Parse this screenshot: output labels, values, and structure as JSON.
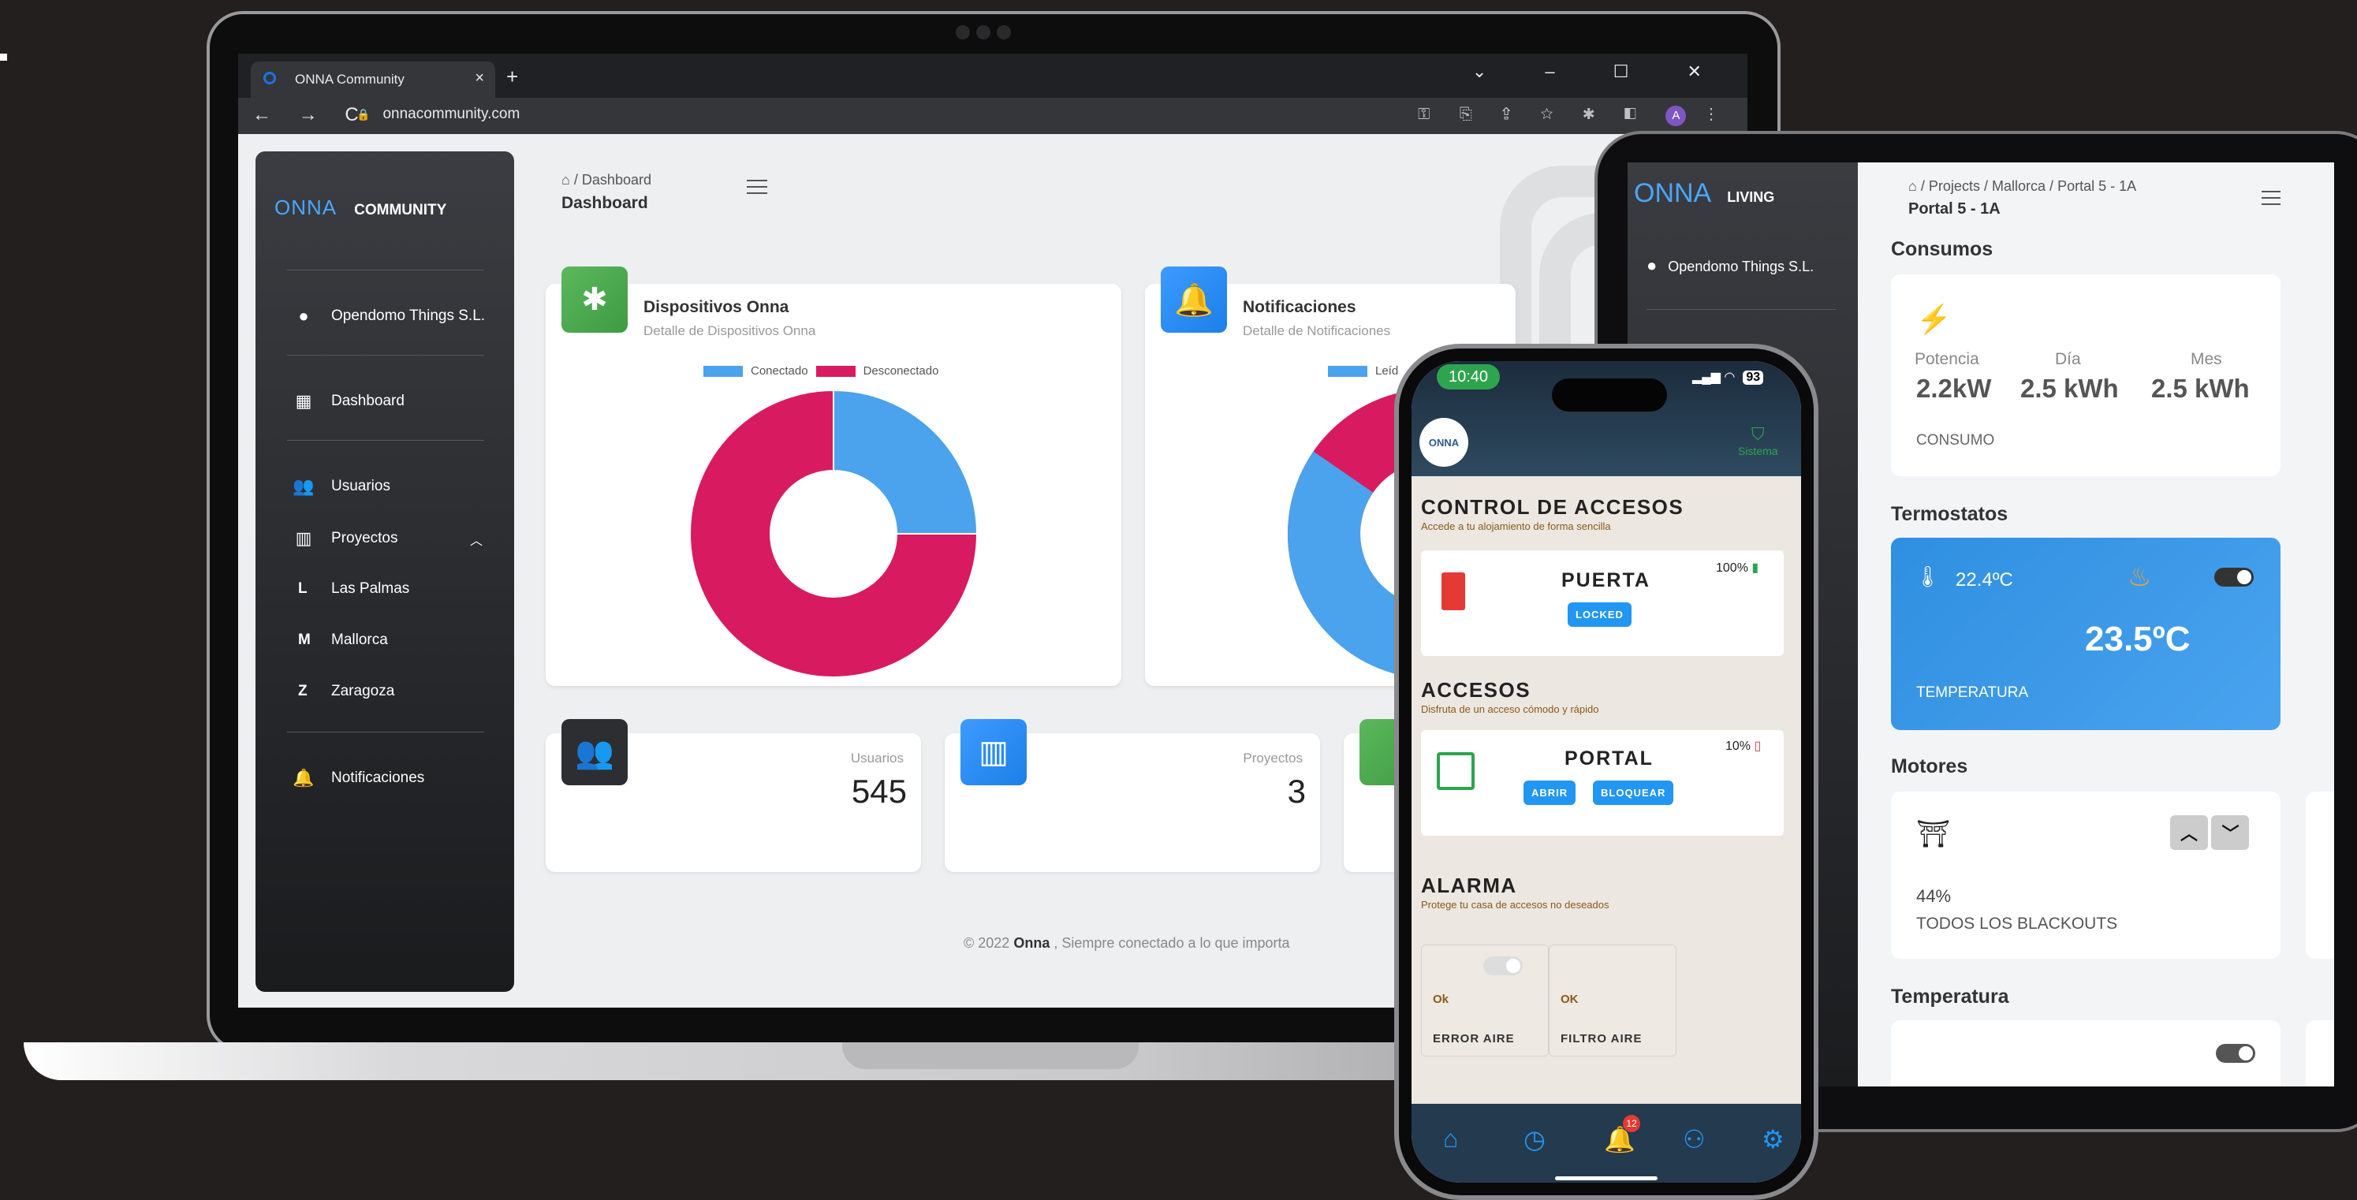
{
  "browser": {
    "tab_title": "ONNA Community",
    "tab_close": "×",
    "new_tab": "+",
    "window_controls": "⌄ – ☐ ✕",
    "nav_controls": "← → C",
    "url": "onnacommunity.com",
    "lock_icon": "🔒",
    "extension_icons": "⚿ ⎘ ⇪ ☆ ✱ ◧",
    "profile_initial": "A"
  },
  "sidebar": {
    "logo_mark": "ONNA",
    "logo_text": "COMMUNITY",
    "company": "Opendomo Things S.L.",
    "items": [
      {
        "icon": "dashboard-icon",
        "label": "Dashboard"
      },
      {
        "icon": "users-icon",
        "label": "Usuarios"
      },
      {
        "icon": "building-icon",
        "label": "Proyectos"
      }
    ],
    "projects": [
      {
        "initial": "L",
        "label": "Las Palmas"
      },
      {
        "initial": "M",
        "label": "Mallorca"
      },
      {
        "initial": "Z",
        "label": "Zaragoza"
      }
    ],
    "notifications": "Notificaciones"
  },
  "header": {
    "breadcrumb_home": "⌂",
    "breadcrumb_sep": "/",
    "breadcrumb": "Dashboard",
    "title": "Dashboard"
  },
  "cards": {
    "devices": {
      "title": "Dispositivos Onna",
      "subtitle": "Detalle de Dispositivos Onna",
      "legend": [
        "Conectado",
        "Desconectado"
      ]
    },
    "notifications": {
      "title": "Notificaciones",
      "subtitle": "Detalle de Notificaciones",
      "legend": [
        "Leíd"
      ]
    }
  },
  "stats": [
    {
      "label": "Usuarios",
      "value": "545"
    },
    {
      "label": "Proyectos",
      "value": "3"
    }
  ],
  "footer": {
    "prefix": "© 2022",
    "brand": "Onna",
    "suffix": ", Siempre conectado a lo que importa"
  },
  "tablet": {
    "logo_mark": "ONNA",
    "logo_text": "LIVING",
    "user": "Opendomo Things S.L.",
    "breadcrumb": [
      "⌂",
      "/",
      "Projects",
      "/",
      "Mallorca",
      "/",
      "Portal 5 - 1A"
    ],
    "title": "Portal 5 - 1A",
    "consumos": {
      "heading": "Consumos",
      "labels": [
        "Potencia",
        "Día",
        "Mes"
      ],
      "values": [
        "2.2kW",
        "2.5 kWh",
        "2.5 kWh"
      ],
      "footer": "CONSUMO"
    },
    "termostatos": {
      "heading": "Termostatos",
      "current": "22.4ºC",
      "target": "23.5ºC",
      "label": "TEMPERATURA"
    },
    "motores": {
      "heading": "Motores",
      "percent": "44%",
      "label": "TODOS LOS BLACKOUTS"
    },
    "temperatura": {
      "heading": "Temperatura"
    }
  },
  "phone": {
    "time": "10:40",
    "battery": "93",
    "logo": "ONNA",
    "system_label": "Sistema",
    "control": {
      "title": "CONTROL DE ACCESOS",
      "subtitle": "Accede a tu alojamiento de forma sencilla",
      "device": "PUERTA",
      "battery": "100%",
      "status": "LOCKED"
    },
    "accesos": {
      "title": "ACCESOS",
      "subtitle": "Disfruta de un acceso cómodo y rápido",
      "device": "PORTAL",
      "battery": "10%",
      "open": "ABRIR",
      "lock": "BLOQUEAR"
    },
    "alarma": {
      "title": "ALARMA",
      "subtitle": "Protege tu casa de accesos no deseados",
      "tiles": [
        {
          "status": "Ok",
          "label": "ERROR AIRE"
        },
        {
          "status": "OK",
          "label": "FILTRO AIRE"
        }
      ]
    },
    "tabbar": {
      "badge": "12"
    }
  },
  "colors": {
    "connected": "#4aa3ec",
    "disconnected": "#d81b60",
    "green": "#4caf50",
    "blue": "#2f8fe0",
    "dark_card": "#2d2e31"
  },
  "chart_data": [
    {
      "type": "pie",
      "title": "Dispositivos Onna",
      "categories": [
        "Conectado",
        "Desconectado"
      ],
      "values": [
        25,
        75
      ]
    }
  ]
}
